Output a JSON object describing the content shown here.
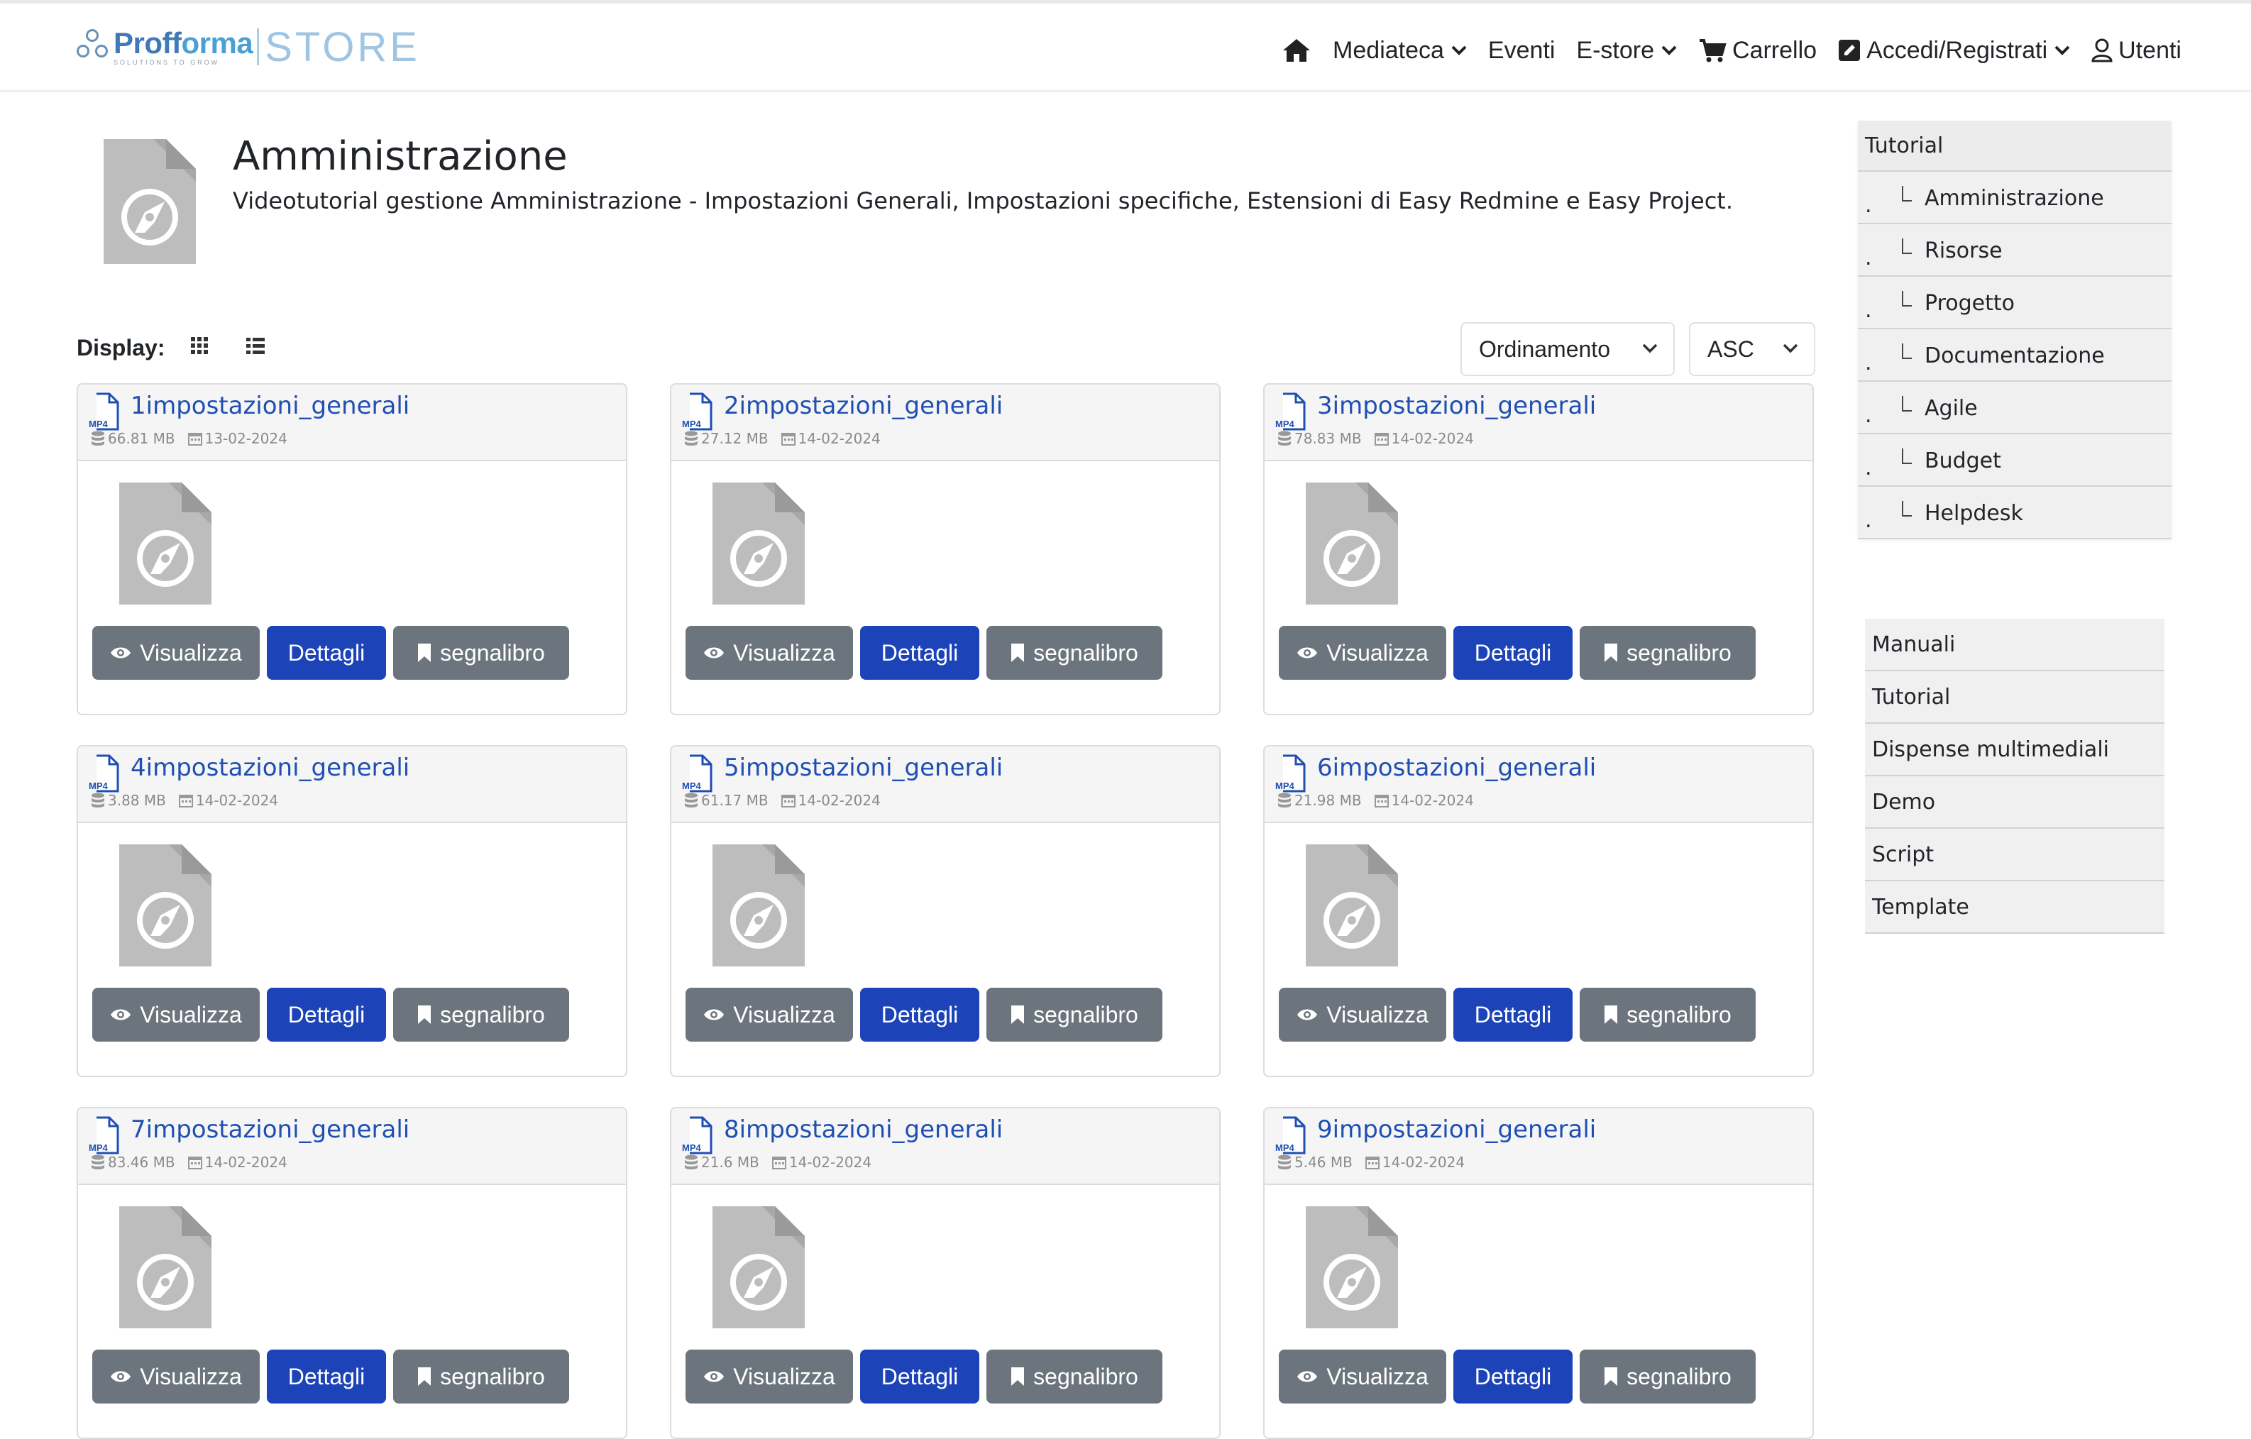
{
  "brand": {
    "name_a": "Proff",
    "name_b": "orma",
    "tagline": "SOLUTIONS TO GROW",
    "store": "STORE"
  },
  "nav": {
    "home_icon": "home-icon",
    "items": [
      {
        "label": "Mediateca",
        "dropdown": true
      },
      {
        "label": "Eventi",
        "dropdown": false
      },
      {
        "label": "E-store",
        "dropdown": true
      },
      {
        "label": "Carrello",
        "icon": "cart-icon",
        "dropdown": false
      },
      {
        "label": "Accedi/Registrati",
        "icon": "login-icon",
        "dropdown": true
      },
      {
        "label": "Utenti",
        "icon": "user-icon",
        "dropdown": false
      }
    ]
  },
  "header": {
    "title": "Amministrazione",
    "description": "Videotutorial gestione Amministrazione - Impostazioni Generali, Impostazioni specifiche, Estensioni di Easy Redmine e Easy Project."
  },
  "display": {
    "label": "Display:",
    "sort_label": "Ordinamento",
    "order_label": "ASC"
  },
  "buttons": {
    "view": "Visualizza",
    "details": "Dettagli",
    "bookmark": "segnalibro"
  },
  "cards": [
    {
      "title": "1impostazioni_generali",
      "size": "66.81 MB",
      "date": "13-02-2024",
      "badge": "MP4"
    },
    {
      "title": "2impostazioni_generali",
      "size": "27.12 MB",
      "date": "14-02-2024",
      "badge": "MP4"
    },
    {
      "title": "3impostazioni_generali",
      "size": "78.83 MB",
      "date": "14-02-2024",
      "badge": "MP4"
    },
    {
      "title": "4impostazioni_generali",
      "size": "3.88 MB",
      "date": "14-02-2024",
      "badge": "MP4"
    },
    {
      "title": "5impostazioni_generali",
      "size": "61.17 MB",
      "date": "14-02-2024",
      "badge": "MP4"
    },
    {
      "title": "6impostazioni_generali",
      "size": "21.98 MB",
      "date": "14-02-2024",
      "badge": "MP4"
    },
    {
      "title": "7impostazioni_generali",
      "size": "83.46 MB",
      "date": "14-02-2024",
      "badge": "MP4"
    },
    {
      "title": "8impostazioni_generali",
      "size": "21.6 MB",
      "date": "14-02-2024",
      "badge": "MP4"
    },
    {
      "title": "9impostazioni_generali",
      "size": "5.46 MB",
      "date": "14-02-2024",
      "badge": "MP4"
    }
  ],
  "sidebar_tree": {
    "header": "Tutorial",
    "bullet": ".",
    "items": [
      "Amministrazione",
      "Risorse",
      "Progetto",
      "Documentazione",
      "Agile",
      "Budget",
      "Helpdesk"
    ]
  },
  "sidebar_categories": [
    "Manuali",
    "Tutorial",
    "Dispense multimediali",
    "Demo",
    "Script",
    "Template"
  ],
  "colors": {
    "primary": "#1c43b8",
    "secondary": "#6c757d",
    "link": "#1f4fb3"
  }
}
